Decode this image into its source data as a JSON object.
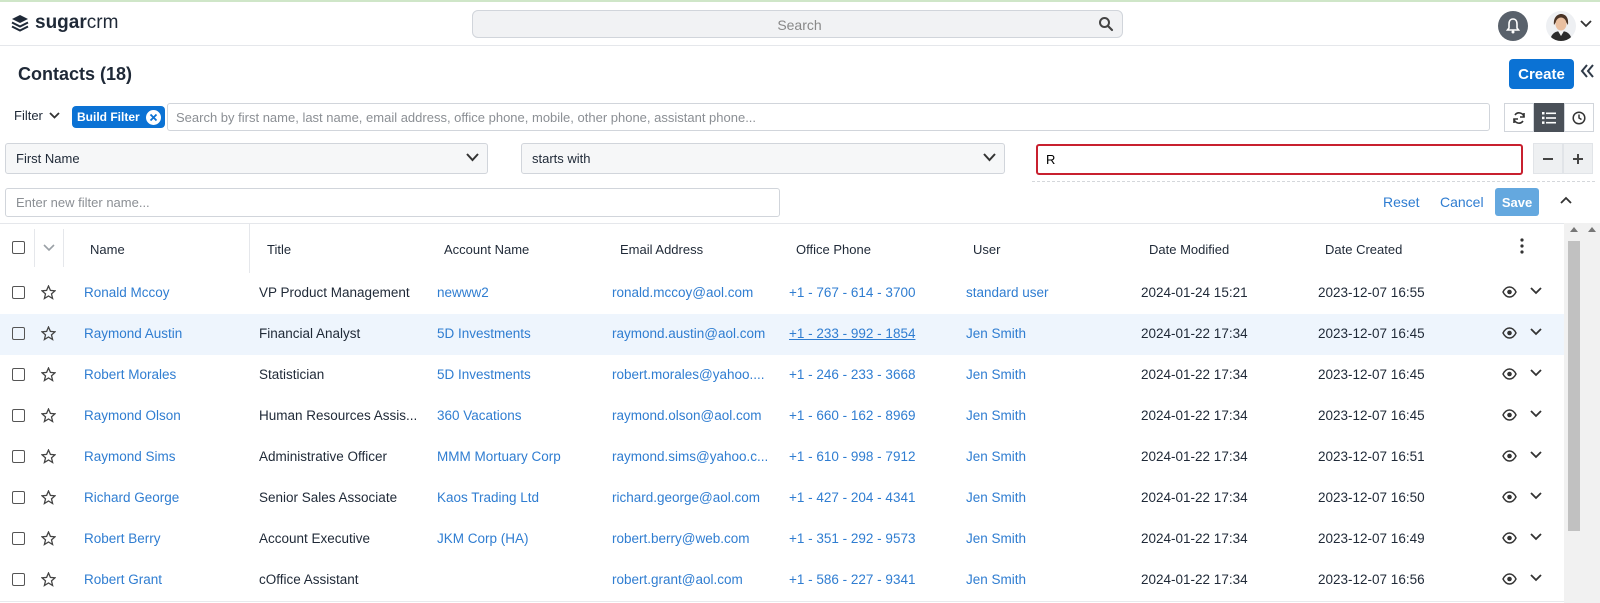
{
  "brand": {
    "logo_text_bold": "sugar",
    "logo_text_light": "crm"
  },
  "search": {
    "placeholder": "Search"
  },
  "page": {
    "title": "Contacts (18)",
    "create_label": "Create"
  },
  "filter": {
    "toggle_label": "Filter",
    "pill_label": "Build Filter",
    "search_placeholder": "Search by first name, last name, email address, office phone, mobile, other phone, assistant phone...",
    "field": "First Name",
    "operator": "starts with",
    "value": "R",
    "name_placeholder": "Enter new filter name...",
    "reset_label": "Reset",
    "cancel_label": "Cancel",
    "save_label": "Save"
  },
  "table": {
    "columns": [
      "Name",
      "Title",
      "Account Name",
      "Email Address",
      "Office Phone",
      "User",
      "Date Modified",
      "Date Created"
    ],
    "rows": [
      {
        "name": "Ronald Mccoy",
        "title": "VP Product Management",
        "account": "newww2",
        "email": "ronald.mccoy@aol.com",
        "phone": "+1 - 767 - 614 - 3700",
        "user": "standard user",
        "modified": "2024-01-24 15:21",
        "created": "2023-12-07 16:55"
      },
      {
        "name": "Raymond Austin",
        "title": "Financial Analyst",
        "account": "5D Investments",
        "email": "raymond.austin@aol.com",
        "phone": "+1 - 233 - 992 - 1854",
        "user": "Jen Smith",
        "modified": "2024-01-22 17:34",
        "created": "2023-12-07 16:45"
      },
      {
        "name": "Robert Morales",
        "title": "Statistician",
        "account": "5D Investments",
        "email": "robert.morales@yahoo....",
        "phone": "+1 - 246 - 233 - 3668",
        "user": "Jen Smith",
        "modified": "2024-01-22 17:34",
        "created": "2023-12-07 16:45"
      },
      {
        "name": "Raymond Olson",
        "title": "Human Resources Assis...",
        "account": "360 Vacations",
        "email": "raymond.olson@aol.com",
        "phone": "+1 - 660 - 162 - 8969",
        "user": "Jen Smith",
        "modified": "2024-01-22 17:34",
        "created": "2023-12-07 16:45"
      },
      {
        "name": "Raymond Sims",
        "title": "Administrative Officer",
        "account": "MMM Mortuary Corp",
        "email": "raymond.sims@yahoo.c...",
        "phone": "+1 - 610 - 998 - 7912",
        "user": "Jen Smith",
        "modified": "2024-01-22 17:34",
        "created": "2023-12-07 16:51"
      },
      {
        "name": "Richard George",
        "title": "Senior Sales Associate",
        "account": "Kaos Trading Ltd",
        "email": "richard.george@aol.com",
        "phone": "+1 - 427 - 204 - 4341",
        "user": "Jen Smith",
        "modified": "2024-01-22 17:34",
        "created": "2023-12-07 16:50"
      },
      {
        "name": "Robert Berry",
        "title": "Account Executive",
        "account": "JKM Corp (HA)",
        "email": "robert.berry@web.com",
        "phone": "+1 - 351 - 292 - 9573",
        "user": "Jen Smith",
        "modified": "2024-01-22 17:34",
        "created": "2023-12-07 16:49"
      },
      {
        "name": "Robert Grant",
        "title": "cOffice Assistant",
        "account": "",
        "email": "robert.grant@aol.com",
        "phone": "+1 - 586 - 227 - 9341",
        "user": "Jen Smith",
        "modified": "2024-01-22 17:34",
        "created": "2023-12-07 16:56"
      }
    ]
  },
  "colors": {
    "accent": "#0b72d4",
    "link": "#2f7dd1",
    "error_border": "#c8202f",
    "row_highlight": "#eef5fd"
  },
  "icons": [
    "logo-icon",
    "search-icon",
    "bell-icon",
    "avatar",
    "chevron-down-icon",
    "double-chevron-left-icon",
    "close-icon",
    "refresh-icon",
    "list-view-icon",
    "clock-icon",
    "minus-icon",
    "plus-icon",
    "chevron-up-icon",
    "kebab-icon",
    "star-icon",
    "eye-icon"
  ]
}
